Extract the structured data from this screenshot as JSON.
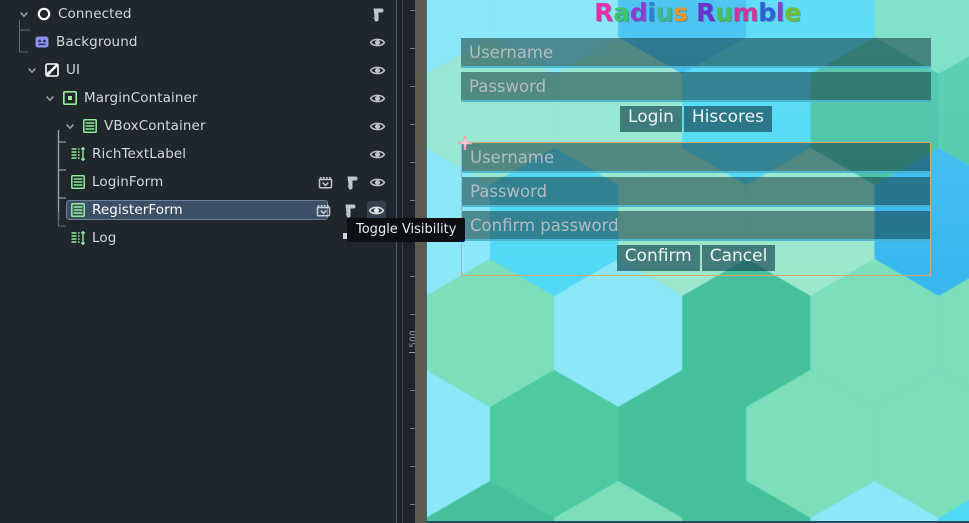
{
  "editor": {
    "scene_tree": {
      "nodes": [
        {
          "label": "Connected",
          "icon": "remote-node-icon",
          "depth": 0,
          "expanded": true,
          "has_script": true,
          "has_anim": false,
          "has_eye": false,
          "selected": false
        },
        {
          "label": "Background",
          "icon": "sprite2d-icon",
          "depth": 1,
          "expanded": null,
          "has_script": false,
          "has_anim": false,
          "has_eye": true,
          "selected": false
        },
        {
          "label": "UI",
          "icon": "canvaslayer-icon",
          "depth": 1,
          "expanded": true,
          "has_script": false,
          "has_anim": false,
          "has_eye": true,
          "selected": false
        },
        {
          "label": "MarginContainer",
          "icon": "margincontainer-icon",
          "depth": 2,
          "expanded": true,
          "has_script": false,
          "has_anim": false,
          "has_eye": true,
          "selected": false
        },
        {
          "label": "VBoxContainer",
          "icon": "vboxcontainer-icon",
          "depth": 3,
          "expanded": true,
          "has_script": false,
          "has_anim": false,
          "has_eye": true,
          "selected": false
        },
        {
          "label": "RichTextLabel",
          "icon": "richtextlabel-icon",
          "depth": 4,
          "expanded": null,
          "has_script": false,
          "has_anim": false,
          "has_eye": true,
          "selected": false
        },
        {
          "label": "LoginForm",
          "icon": "vboxcontainer-icon",
          "depth": 4,
          "expanded": null,
          "has_script": true,
          "has_anim": true,
          "has_eye": true,
          "selected": false
        },
        {
          "label": "RegisterForm",
          "icon": "vboxcontainer-icon",
          "depth": 4,
          "expanded": null,
          "has_script": true,
          "has_anim": true,
          "has_eye": true,
          "selected": true
        },
        {
          "label": "Log",
          "icon": "richtextlabel-icon",
          "depth": 4,
          "expanded": null,
          "has_script": false,
          "has_anim": false,
          "has_eye": false,
          "selected": false
        }
      ]
    },
    "tooltip": {
      "text": "Toggle Visibility"
    },
    "ruler": {
      "labels": [
        "500"
      ]
    },
    "colors": {
      "panel_bg": "#21262d",
      "selection_bg": "#3d4f66",
      "selection_border": "#6b8099",
      "node_icon_green": "#8eef97",
      "tooltip_bg": "#0e0f12",
      "ruler_bg": "#1e232b",
      "gutter": "#5c5a51"
    }
  },
  "game": {
    "title": {
      "text": "Radius Rumble",
      "letters": [
        {
          "ch": "R",
          "color": "#e331ab"
        },
        {
          "ch": "a",
          "color": "#3fc46a"
        },
        {
          "ch": "d",
          "color": "#8c3ccf"
        },
        {
          "ch": "i",
          "color": "#2b7fd8"
        },
        {
          "ch": "u",
          "color": "#3fb98b"
        },
        {
          "ch": "s",
          "color": "#e8952a"
        },
        {
          "ch": " ",
          "color": "#ffffff"
        },
        {
          "ch": "R",
          "color": "#6a32cf"
        },
        {
          "ch": "u",
          "color": "#46c152"
        },
        {
          "ch": "m",
          "color": "#d4339c"
        },
        {
          "ch": "b",
          "color": "#2f5fd0"
        },
        {
          "ch": "l",
          "color": "#8c3ccf"
        },
        {
          "ch": "e",
          "color": "#6fbf2f"
        }
      ]
    },
    "login_form": {
      "fields": [
        {
          "placeholder": "Username",
          "name": "login-username-input"
        },
        {
          "placeholder": "Password",
          "name": "login-password-input"
        }
      ],
      "buttons": [
        {
          "label": "Login",
          "name": "login-button"
        },
        {
          "label": "Hiscores",
          "name": "hiscores-button"
        }
      ]
    },
    "register_form": {
      "fields": [
        {
          "placeholder": "Username",
          "name": "register-username-input"
        },
        {
          "placeholder": "Password",
          "name": "register-password-input"
        },
        {
          "placeholder": "Confirm password",
          "name": "register-confirm-password-input"
        }
      ],
      "buttons": [
        {
          "label": "Confirm",
          "name": "confirm-button"
        },
        {
          "label": "Cancel",
          "name": "cancel-button"
        }
      ]
    },
    "background": {
      "palette": [
        "#4fd9f5",
        "#8ce8f9",
        "#7ddfb9",
        "#4ec9a0",
        "#46bf9b",
        "#9de8cc",
        "#37b7f0"
      ]
    }
  }
}
